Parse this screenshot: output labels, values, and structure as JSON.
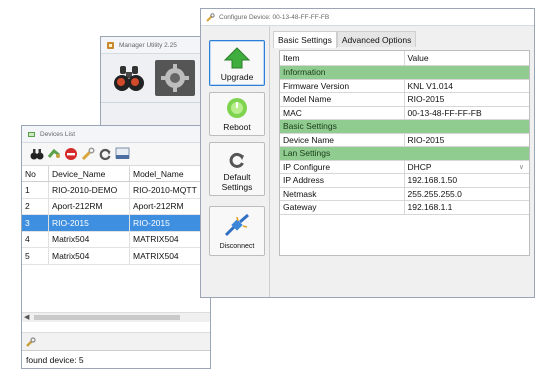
{
  "manager_window": {
    "title": "Manager Utility 2.25"
  },
  "devices_window": {
    "title": "Devices List",
    "columns": [
      "No",
      "Device_Name",
      "Model_Name"
    ],
    "rows": [
      {
        "no": "1",
        "device": "RIO-2010-DEMO",
        "model": "RIO-2010-MQTT",
        "selected": false
      },
      {
        "no": "2",
        "device": "Aport-212RM",
        "model": "Aport-212RM",
        "selected": false
      },
      {
        "no": "3",
        "device": "RIO-2015",
        "model": "RIO-2015",
        "selected": true
      },
      {
        "no": "4",
        "device": "Matrix504",
        "model": "MATRIX504",
        "selected": false
      },
      {
        "no": "5",
        "device": "Matrix504",
        "model": "MATRIX504",
        "selected": false
      }
    ],
    "status": "found device: 5"
  },
  "config_window": {
    "title": "Configure Device: 00-13-48-FF-FF-FB",
    "side_buttons": {
      "upgrade": "Upgrade",
      "reboot": "Reboot",
      "default_settings_line1": "Default",
      "default_settings_line2": "Settings",
      "disconnect": "Disconnect"
    },
    "tabs": {
      "basic": "Basic Settings",
      "advanced": "Advanced Options"
    },
    "table": {
      "header": {
        "item": "Item",
        "value": "Value"
      },
      "information": "Information",
      "firmware_label": "Firmware Version",
      "firmware_value": "KNL V1.014",
      "model_label": "Model Name",
      "model_value": "RIO-2015",
      "mac_label": "MAC",
      "mac_value": "00-13-48-FF-FF-FB",
      "basic_settings": "Basic Settings",
      "device_name_label": "Device Name",
      "device_name_value": "RIO-2015",
      "lan_settings": "Lan Settings",
      "ip_configure_label": "IP Configure",
      "ip_configure_value": "DHCP",
      "ip_address_label": "IP Address",
      "ip_address_value": "192.168.1.50",
      "netmask_label": "Netmask",
      "netmask_value": "255.255.255.0",
      "gateway_label": "Gateway",
      "gateway_value": "192.168.1.1"
    }
  },
  "colors": {
    "selection": "#3f8fe0",
    "section_row": "#90cc8f",
    "active_button_border": "#2c7fd6"
  }
}
